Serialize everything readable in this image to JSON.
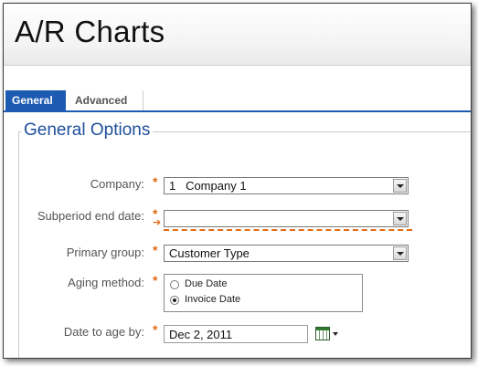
{
  "app": {
    "title": "A/R Charts"
  },
  "tabs": [
    {
      "label": "General",
      "active": true
    },
    {
      "label": "Advanced",
      "active": false
    }
  ],
  "section": {
    "title": "General Options"
  },
  "fields": {
    "company": {
      "label": "Company:",
      "value": "1   Company 1",
      "required": true
    },
    "subperiod": {
      "label": "Subperiod end date:",
      "value": "",
      "required": true
    },
    "primary_group": {
      "label": "Primary group:",
      "value": "Customer Type",
      "required": true
    },
    "aging_method": {
      "label": "Aging method:",
      "required": true,
      "options": [
        "Due Date",
        "Invoice Date"
      ],
      "selected": "Invoice Date"
    },
    "date_to_age": {
      "label": "Date to age by:",
      "value": "Dec 2, 2011",
      "required": true
    }
  },
  "colors": {
    "accent": "#1d5bb3",
    "required": "#e26a15",
    "section_title": "#1f4f9c"
  },
  "icons": [
    "dropdown-arrow-icon",
    "calendar-icon",
    "required-asterisk-icon"
  ]
}
